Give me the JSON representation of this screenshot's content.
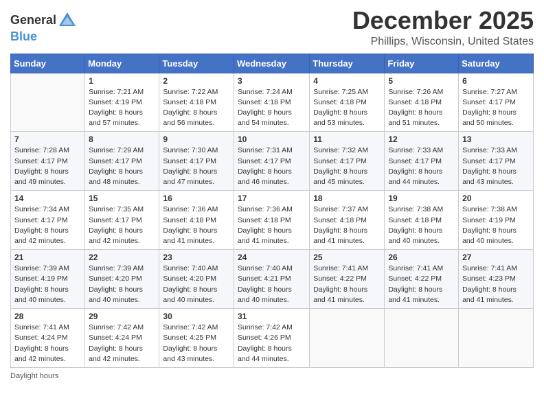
{
  "header": {
    "logo_general": "General",
    "logo_blue": "Blue",
    "month": "December 2025",
    "location": "Phillips, Wisconsin, United States"
  },
  "weekdays": [
    "Sunday",
    "Monday",
    "Tuesday",
    "Wednesday",
    "Thursday",
    "Friday",
    "Saturday"
  ],
  "weeks": [
    [
      {
        "day": "",
        "sunrise": "",
        "sunset": "",
        "daylight": ""
      },
      {
        "day": "1",
        "sunrise": "Sunrise: 7:21 AM",
        "sunset": "Sunset: 4:19 PM",
        "daylight": "Daylight: 8 hours and 57 minutes."
      },
      {
        "day": "2",
        "sunrise": "Sunrise: 7:22 AM",
        "sunset": "Sunset: 4:18 PM",
        "daylight": "Daylight: 8 hours and 56 minutes."
      },
      {
        "day": "3",
        "sunrise": "Sunrise: 7:24 AM",
        "sunset": "Sunset: 4:18 PM",
        "daylight": "Daylight: 8 hours and 54 minutes."
      },
      {
        "day": "4",
        "sunrise": "Sunrise: 7:25 AM",
        "sunset": "Sunset: 4:18 PM",
        "daylight": "Daylight: 8 hours and 53 minutes."
      },
      {
        "day": "5",
        "sunrise": "Sunrise: 7:26 AM",
        "sunset": "Sunset: 4:18 PM",
        "daylight": "Daylight: 8 hours and 51 minutes."
      },
      {
        "day": "6",
        "sunrise": "Sunrise: 7:27 AM",
        "sunset": "Sunset: 4:17 PM",
        "daylight": "Daylight: 8 hours and 50 minutes."
      }
    ],
    [
      {
        "day": "7",
        "sunrise": "Sunrise: 7:28 AM",
        "sunset": "Sunset: 4:17 PM",
        "daylight": "Daylight: 8 hours and 49 minutes."
      },
      {
        "day": "8",
        "sunrise": "Sunrise: 7:29 AM",
        "sunset": "Sunset: 4:17 PM",
        "daylight": "Daylight: 8 hours and 48 minutes."
      },
      {
        "day": "9",
        "sunrise": "Sunrise: 7:30 AM",
        "sunset": "Sunset: 4:17 PM",
        "daylight": "Daylight: 8 hours and 47 minutes."
      },
      {
        "day": "10",
        "sunrise": "Sunrise: 7:31 AM",
        "sunset": "Sunset: 4:17 PM",
        "daylight": "Daylight: 8 hours and 46 minutes."
      },
      {
        "day": "11",
        "sunrise": "Sunrise: 7:32 AM",
        "sunset": "Sunset: 4:17 PM",
        "daylight": "Daylight: 8 hours and 45 minutes."
      },
      {
        "day": "12",
        "sunrise": "Sunrise: 7:33 AM",
        "sunset": "Sunset: 4:17 PM",
        "daylight": "Daylight: 8 hours and 44 minutes."
      },
      {
        "day": "13",
        "sunrise": "Sunrise: 7:33 AM",
        "sunset": "Sunset: 4:17 PM",
        "daylight": "Daylight: 8 hours and 43 minutes."
      }
    ],
    [
      {
        "day": "14",
        "sunrise": "Sunrise: 7:34 AM",
        "sunset": "Sunset: 4:17 PM",
        "daylight": "Daylight: 8 hours and 42 minutes."
      },
      {
        "day": "15",
        "sunrise": "Sunrise: 7:35 AM",
        "sunset": "Sunset: 4:17 PM",
        "daylight": "Daylight: 8 hours and 42 minutes."
      },
      {
        "day": "16",
        "sunrise": "Sunrise: 7:36 AM",
        "sunset": "Sunset: 4:18 PM",
        "daylight": "Daylight: 8 hours and 41 minutes."
      },
      {
        "day": "17",
        "sunrise": "Sunrise: 7:36 AM",
        "sunset": "Sunset: 4:18 PM",
        "daylight": "Daylight: 8 hours and 41 minutes."
      },
      {
        "day": "18",
        "sunrise": "Sunrise: 7:37 AM",
        "sunset": "Sunset: 4:18 PM",
        "daylight": "Daylight: 8 hours and 41 minutes."
      },
      {
        "day": "19",
        "sunrise": "Sunrise: 7:38 AM",
        "sunset": "Sunset: 4:18 PM",
        "daylight": "Daylight: 8 hours and 40 minutes."
      },
      {
        "day": "20",
        "sunrise": "Sunrise: 7:38 AM",
        "sunset": "Sunset: 4:19 PM",
        "daylight": "Daylight: 8 hours and 40 minutes."
      }
    ],
    [
      {
        "day": "21",
        "sunrise": "Sunrise: 7:39 AM",
        "sunset": "Sunset: 4:19 PM",
        "daylight": "Daylight: 8 hours and 40 minutes."
      },
      {
        "day": "22",
        "sunrise": "Sunrise: 7:39 AM",
        "sunset": "Sunset: 4:20 PM",
        "daylight": "Daylight: 8 hours and 40 minutes."
      },
      {
        "day": "23",
        "sunrise": "Sunrise: 7:40 AM",
        "sunset": "Sunset: 4:20 PM",
        "daylight": "Daylight: 8 hours and 40 minutes."
      },
      {
        "day": "24",
        "sunrise": "Sunrise: 7:40 AM",
        "sunset": "Sunset: 4:21 PM",
        "daylight": "Daylight: 8 hours and 40 minutes."
      },
      {
        "day": "25",
        "sunrise": "Sunrise: 7:41 AM",
        "sunset": "Sunset: 4:22 PM",
        "daylight": "Daylight: 8 hours and 41 minutes."
      },
      {
        "day": "26",
        "sunrise": "Sunrise: 7:41 AM",
        "sunset": "Sunset: 4:22 PM",
        "daylight": "Daylight: 8 hours and 41 minutes."
      },
      {
        "day": "27",
        "sunrise": "Sunrise: 7:41 AM",
        "sunset": "Sunset: 4:23 PM",
        "daylight": "Daylight: 8 hours and 41 minutes."
      }
    ],
    [
      {
        "day": "28",
        "sunrise": "Sunrise: 7:41 AM",
        "sunset": "Sunset: 4:24 PM",
        "daylight": "Daylight: 8 hours and 42 minutes."
      },
      {
        "day": "29",
        "sunrise": "Sunrise: 7:42 AM",
        "sunset": "Sunset: 4:24 PM",
        "daylight": "Daylight: 8 hours and 42 minutes."
      },
      {
        "day": "30",
        "sunrise": "Sunrise: 7:42 AM",
        "sunset": "Sunset: 4:25 PM",
        "daylight": "Daylight: 8 hours and 43 minutes."
      },
      {
        "day": "31",
        "sunrise": "Sunrise: 7:42 AM",
        "sunset": "Sunset: 4:26 PM",
        "daylight": "Daylight: 8 hours and 44 minutes."
      },
      {
        "day": "",
        "sunrise": "",
        "sunset": "",
        "daylight": ""
      },
      {
        "day": "",
        "sunrise": "",
        "sunset": "",
        "daylight": ""
      },
      {
        "day": "",
        "sunrise": "",
        "sunset": "",
        "daylight": ""
      }
    ]
  ],
  "footer": {
    "daylight_label": "Daylight hours"
  }
}
